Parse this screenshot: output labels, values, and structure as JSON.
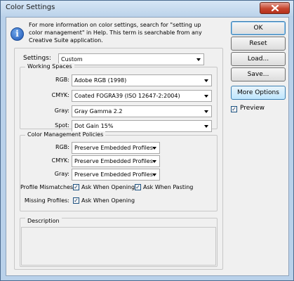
{
  "window": {
    "title": "Color Settings"
  },
  "info": {
    "text_line1": "For more information on color settings, search for \"setting up",
    "text_line2": "color management\" in Help. This term is searchable from any",
    "text_line3": "Creative Suite application."
  },
  "settings": {
    "label": "Settings:",
    "value": "Custom"
  },
  "working_spaces": {
    "title": "Working Spaces",
    "rgb": {
      "label": "RGB:",
      "value": "Adobe RGB (1998)"
    },
    "cmyk": {
      "label": "CMYK:",
      "value": "Coated FOGRA39 (ISO 12647-2:2004)"
    },
    "gray": {
      "label": "Gray:",
      "value": "Gray Gamma 2.2"
    },
    "spot": {
      "label": "Spot:",
      "value": "Dot Gain 15%"
    }
  },
  "policies": {
    "title": "Color Management Policies",
    "rgb": {
      "label": "RGB:",
      "value": "Preserve Embedded Profiles"
    },
    "cmyk": {
      "label": "CMYK:",
      "value": "Preserve Embedded Profiles"
    },
    "gray": {
      "label": "Gray:",
      "value": "Preserve Embedded Profiles"
    },
    "profile_mismatches": {
      "label": "Profile Mismatches:",
      "ask_opening": {
        "label": "Ask When Opening",
        "checked": true
      },
      "ask_pasting": {
        "label": "Ask When Pasting",
        "checked": true
      }
    },
    "missing_profiles": {
      "label": "Missing Profiles:",
      "ask_opening": {
        "label": "Ask When Opening",
        "checked": true
      }
    }
  },
  "description": {
    "title": "Description"
  },
  "buttons": {
    "ok": "OK",
    "reset": "Reset",
    "load": "Load...",
    "save": "Save...",
    "more_options": "More Options"
  },
  "preview": {
    "label": "Preview",
    "checked": true
  },
  "icons": {
    "info": "info-icon",
    "close": "close-icon",
    "check": "check-icon",
    "dropdown": "chevron-down-icon"
  },
  "colors": {
    "titlebar": "#bcd3ea",
    "dialog_bg": "#f0f0f0",
    "close_button": "#c6452e",
    "focus_border": "#3c7fb1"
  }
}
